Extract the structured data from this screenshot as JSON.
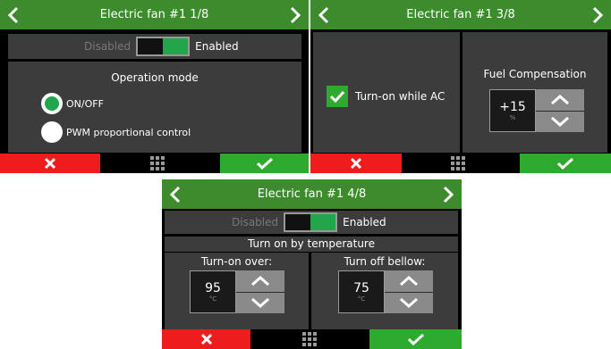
{
  "screen1": {
    "title": "Electric fan #1 1/8",
    "toggle": {
      "off_label": "Disabled",
      "on_label": "Enabled",
      "state": "on"
    },
    "section_title": "Operation mode",
    "options": [
      {
        "label": "ON/OFF",
        "selected": true
      },
      {
        "label": "PWM proportional control",
        "selected": false
      }
    ]
  },
  "screen2": {
    "title": "Electric fan #1 3/8",
    "checkbox": {
      "label": "Turn-on while AC",
      "checked": true
    },
    "fuel": {
      "label": "Fuel Compensation",
      "value": "+15",
      "unit": "%"
    }
  },
  "screen3": {
    "title": "Electric fan #1 4/8",
    "toggle": {
      "off_label": "Disabled",
      "on_label": "Enabled",
      "state": "on"
    },
    "section_title": "Turn on by temperature",
    "turn_on": {
      "label": "Turn-on over:",
      "value": "95",
      "unit": "°C"
    },
    "turn_off": {
      "label": "Turn off bellow:",
      "value": "75",
      "unit": "°C"
    }
  },
  "colors": {
    "header": "#3c8c2e",
    "cancel": "#ee1c1c",
    "confirm": "#2eaa2e",
    "toggle_on": "#22a64c",
    "panel": "#3c3c3c"
  },
  "icons": [
    "chevron-left-icon",
    "chevron-right-icon",
    "close-icon",
    "grid-menu-icon",
    "checkmark-icon"
  ]
}
